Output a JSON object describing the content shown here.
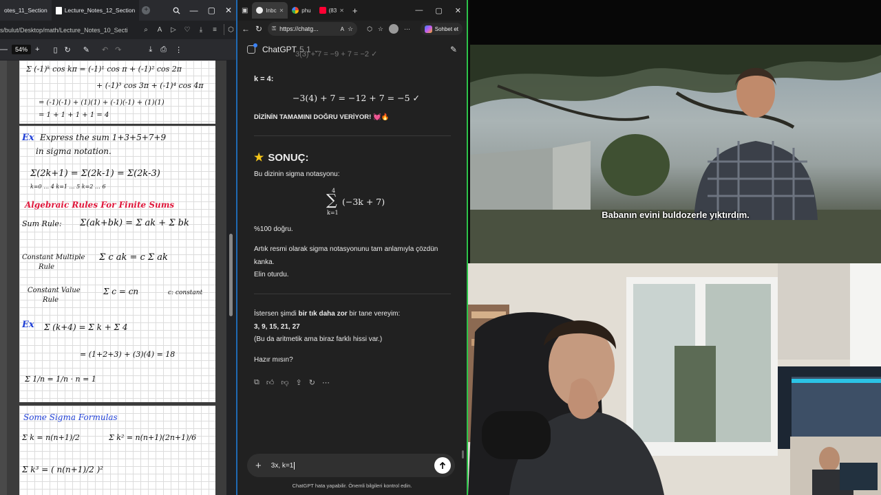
{
  "pdf_viewer": {
    "tabs": [
      {
        "label": "otes_11_Section"
      },
      {
        "label": "Lecture_Notes_12_Section"
      }
    ],
    "url": "s/bulut/Desktop/math/Lecture_Notes_10_Secti",
    "zoom": "54%",
    "notes": {
      "top": {
        "line1": "Σ (-1)ᵏ cos kπ = (-1)¹ cos π + (-1)² cos 2π",
        "line2": "+ (-1)³ cos 3π + (-1)⁴ cos 4π",
        "line3": "= (-1)(-1) + (1)(1) + (-1)(-1) + (1)(1)",
        "line4": "= 1 + 1 + 1 + 1 = 4"
      },
      "ex1_label": "Ex",
      "ex1_line1": "Express the sum 1+3+5+7+9",
      "ex1_line2": "in sigma notation.",
      "ex1_sums": "Σ(2k+1) = Σ(2k-1) = Σ(2k-3)",
      "ex1_bounds": "k=0 … 4     k=1 … 5     k=2 … 6",
      "rules_title": "Algebraic Rules For Finite Sums",
      "sum_rule": "Sum Rule:",
      "sum_rule_eq": "Σ(ak+bk) = Σ ak + Σ bk",
      "const_mult": "Constant Multiple",
      "const_mult2": "Rule",
      "const_mult_eq": "Σ c ak = c Σ ak",
      "const_val": "Constant Value",
      "const_val2": "Rule",
      "const_val_eq": "Σ c = cn",
      "const_note": "c: constant",
      "ex2_label": "Ex",
      "ex2_eq": "Σ (k+4) = Σ k + Σ 4",
      "ex2_result": "= (1+2+3) + (3)(4) = 18",
      "ex2_frac": "Σ 1/n = 1/n · n = 1",
      "formulas_title": "Some Sigma Formulas",
      "f1": "Σ k = n(n+1)/2",
      "f2": "Σ k² = n(n+1)(2n+1)/6",
      "f3": "Σ k³ = ( n(n+1)/2 )²"
    }
  },
  "browser": {
    "tabs": [
      {
        "label": "Inbc",
        "icon": "chatgpt-icon"
      },
      {
        "label": "phu",
        "icon": "google-icon"
      },
      {
        "label": "(83",
        "icon": "youtube-icon"
      }
    ],
    "url": "https://chatg...",
    "sohbet_label": "Sohbet et"
  },
  "chat": {
    "model": "ChatGPT",
    "version": "5.1",
    "k4_label": "k = 4:",
    "k4_eq": "−3(4) + 7 = −12 + 7 = −5  ✓",
    "correct_line": "DİZİNİN TAMAMINI DOĞRU VERİYOR!",
    "correct_emoji": "💓🔥",
    "result_heading": "SONUÇ:",
    "sigma_intro": "Bu dizinin sigma notasyonu:",
    "sigma_upper": "4",
    "sigma_expr": "(−3k + 7)",
    "sigma_lower": "k=1",
    "percent": "%100 doğru.",
    "para1_a": "Artık resmi olarak sigma notasyonunu tam anlamıyla çözdün",
    "para1_b": "kanka.",
    "para1_c": "Elin oturdu.",
    "offer_pre": "İstersen şimdi ",
    "offer_bold": "bir tık daha zor",
    "offer_post": " bir tane vereyim:",
    "sequence": "3, 9, 15, 21, 27",
    "hint": "(Bu da aritmetik ama biraz farklı hissi var.)",
    "ready": "Hazır mısın?",
    "input_value": "3x, k=1",
    "disclaimer": "ChatGPT hata yapabilir. Önemli bilgileri kontrol edin."
  },
  "video": {
    "subtitle": "Babanın evini buldozerle yıktırdım."
  }
}
